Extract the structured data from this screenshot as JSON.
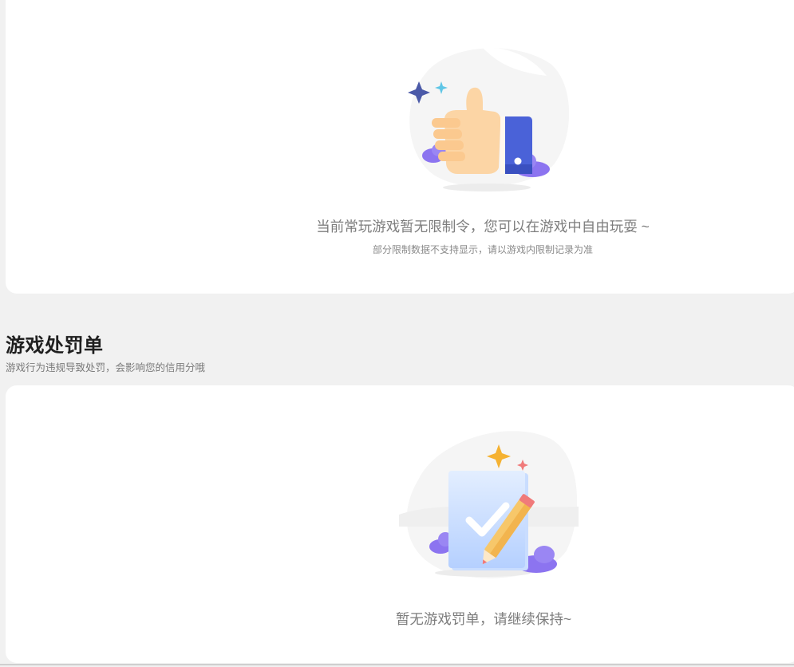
{
  "restriction_panel": {
    "empty_title": "当前常玩游戏暂无限制令，您可以在游戏中自由玩耍 ~",
    "empty_subtitle": "部分限制数据不支持显示，请以游戏内限制记录为准",
    "illustration_icon": "thumbs-up-icon"
  },
  "penalty_section": {
    "title": "游戏处罚单",
    "subtitle": "游戏行为违规导致处罚，会影响您的信用分哦",
    "empty_title": "暂无游戏罚单，请继续保持~",
    "illustration_icon": "checked-document-pencil-icon"
  },
  "colors": {
    "background": "#f1f1f1",
    "card": "#ffffff",
    "primary_text": "#1f1f1f",
    "muted_text": "#7d7d7d",
    "cuff_blue": "#4a62d8",
    "cloud_purple": "#8c74f0",
    "sparkle_navy": "#4b5aa8",
    "sparkle_cyan": "#5fc6e6",
    "sparkle_orange": "#f5b232",
    "sparkle_red": "#f07a7a"
  }
}
